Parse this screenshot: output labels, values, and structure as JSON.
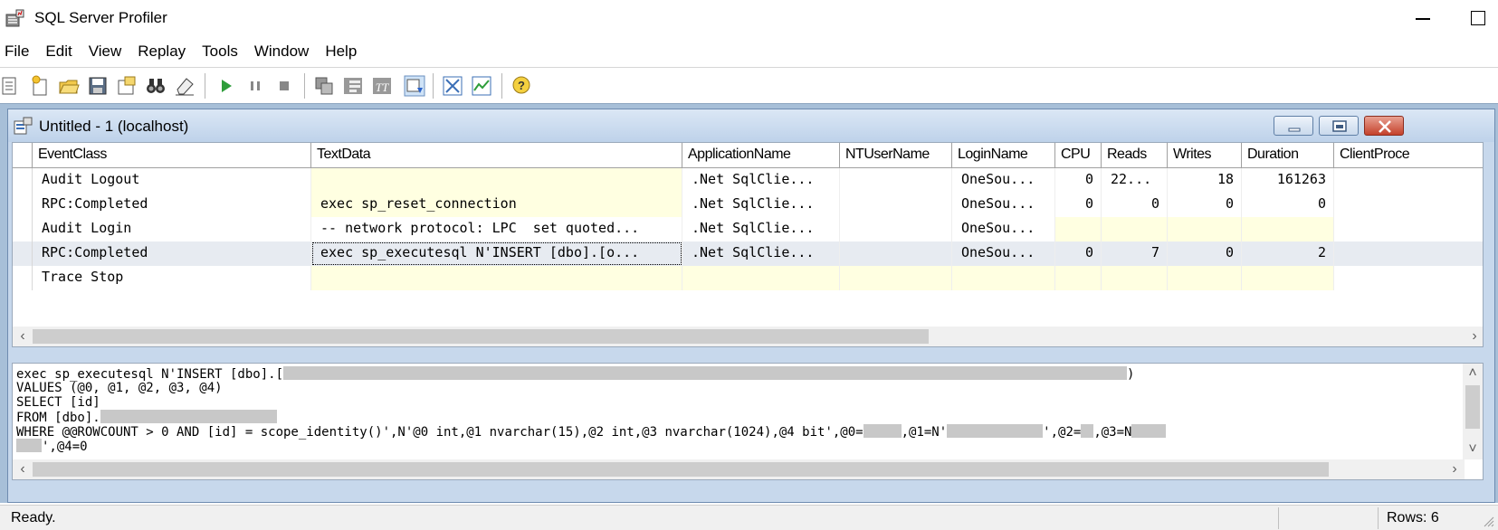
{
  "app": {
    "title": "SQL Server Profiler"
  },
  "menu": [
    "File",
    "Edit",
    "View",
    "Replay",
    "Tools",
    "Window",
    "Help"
  ],
  "child": {
    "title": "Untitled - 1 (localhost)"
  },
  "grid": {
    "columns": [
      "EventClass",
      "TextData",
      "ApplicationName",
      "NTUserName",
      "LoginName",
      "CPU",
      "Reads",
      "Writes",
      "Duration",
      "ClientProce"
    ],
    "rows": [
      {
        "EventClass": "Audit Logout",
        "TextData": "",
        "ApplicationName": ".Net SqlClie...",
        "NTUserName": "",
        "LoginName": "OneSou...",
        "CPU": "0",
        "Reads": "22...",
        "Writes": "18",
        "Duration": "161263"
      },
      {
        "EventClass": "RPC:Completed",
        "TextData": "exec sp_reset_connection",
        "ApplicationName": ".Net SqlClie...",
        "NTUserName": "",
        "LoginName": "OneSou...",
        "CPU": "0",
        "Reads": "0",
        "Writes": "0",
        "Duration": "0"
      },
      {
        "EventClass": "Audit Login",
        "TextData": "-- network protocol: LPC  set quoted...",
        "ApplicationName": ".Net SqlClie...",
        "NTUserName": "",
        "LoginName": "OneSou...",
        "CPU": "",
        "Reads": "",
        "Writes": "",
        "Duration": ""
      },
      {
        "EventClass": "RPC:Completed",
        "TextData": "exec sp_executesql N'INSERT [dbo].[o...",
        "ApplicationName": ".Net SqlClie...",
        "NTUserName": "",
        "LoginName": "OneSou...",
        "CPU": "0",
        "Reads": "7",
        "Writes": "0",
        "Duration": "2"
      },
      {
        "EventClass": "Trace Stop",
        "TextData": "",
        "ApplicationName": "",
        "NTUserName": "",
        "LoginName": "",
        "CPU": "",
        "Reads": "",
        "Writes": "",
        "Duration": ""
      }
    ]
  },
  "detail": {
    "line1": "exec sp_executesql N'INSERT [dbo].[",
    "line1_end": ")",
    "line2": "VALUES (@0, @1, @2, @3, @4)",
    "line3": "SELECT [id]",
    "line4": "FROM [dbo].",
    "line5a": "WHERE @@ROWCOUNT > 0 AND [id] = scope_identity()',N'@0 int,@1 nvarchar(15),@2 int,@3 nvarchar(1024),@4 bit',@0=",
    "line5b": ",@1=N'",
    "line5c": "',@2=",
    "line5d": ",@3=N",
    "line6": "',@4=0"
  },
  "status": {
    "text": "Ready.",
    "rows": "Rows: 6"
  }
}
